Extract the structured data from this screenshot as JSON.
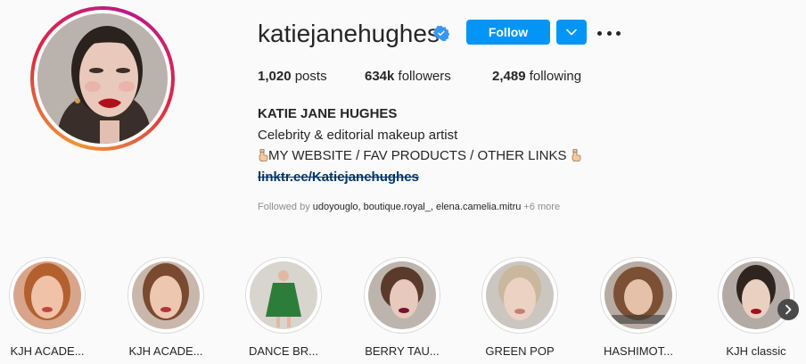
{
  "profile": {
    "username": "katiejanehughes",
    "follow_label": "Follow",
    "posts_count": "1,020",
    "posts_label": "posts",
    "followers_count": "634k",
    "followers_label": "followers",
    "following_count": "2,489",
    "following_label": "following",
    "full_name": "KATIE JANE HUGHES",
    "bio_line1": "Celebrity & editorial makeup artist",
    "bio_line2": "MY WEBSITE / FAV PRODUCTS / OTHER LINKS",
    "link": "linktr.ee/Katiejanehughes",
    "followed_by_prefix": "Followed by",
    "followed_by_names": "udoyouglo, boutique.royal_, elena.camelia.mitru",
    "followed_by_more": "+6 more"
  },
  "icons": {
    "verified": "verified-badge-icon",
    "dropdown": "chevron-down-icon",
    "more": "more-options-icon",
    "pointing_hand": "hand-pointing-down-icon",
    "next": "chevron-right-icon"
  },
  "colors": {
    "accent": "#0095f6",
    "text": "#262626",
    "muted": "#8e8e8e",
    "link": "#00376b",
    "background": "#fafafa"
  },
  "highlights": [
    {
      "label": "KJH ACADE...",
      "bg": "#d9a58a",
      "face": "#f0c2a8",
      "hair": "#b4602e"
    },
    {
      "label": "KJH ACADE...",
      "bg": "#c9b7ac",
      "face": "#eec7b0",
      "hair": "#7a4a30"
    },
    {
      "label": "DANCE BR...",
      "bg": "#d8d4ce",
      "face": "#2d7d3a",
      "hair": "#2d7d3a"
    },
    {
      "label": "BERRY TAU...",
      "bg": "#bdb4ae",
      "face": "#e7c9bd",
      "hair": "#5a3a2a"
    },
    {
      "label": "GREEN POP",
      "bg": "#ccc6c1",
      "face": "#ecd2c2",
      "hair": "#c9b79e"
    },
    {
      "label": "HASHIMOT...",
      "bg": "#b8aba3",
      "face": "#e5c1aa",
      "hair": "#7b5035"
    },
    {
      "label": "KJH classic",
      "bg": "#b3aaa5",
      "face": "#ead0c1",
      "hair": "#2f2420"
    }
  ]
}
